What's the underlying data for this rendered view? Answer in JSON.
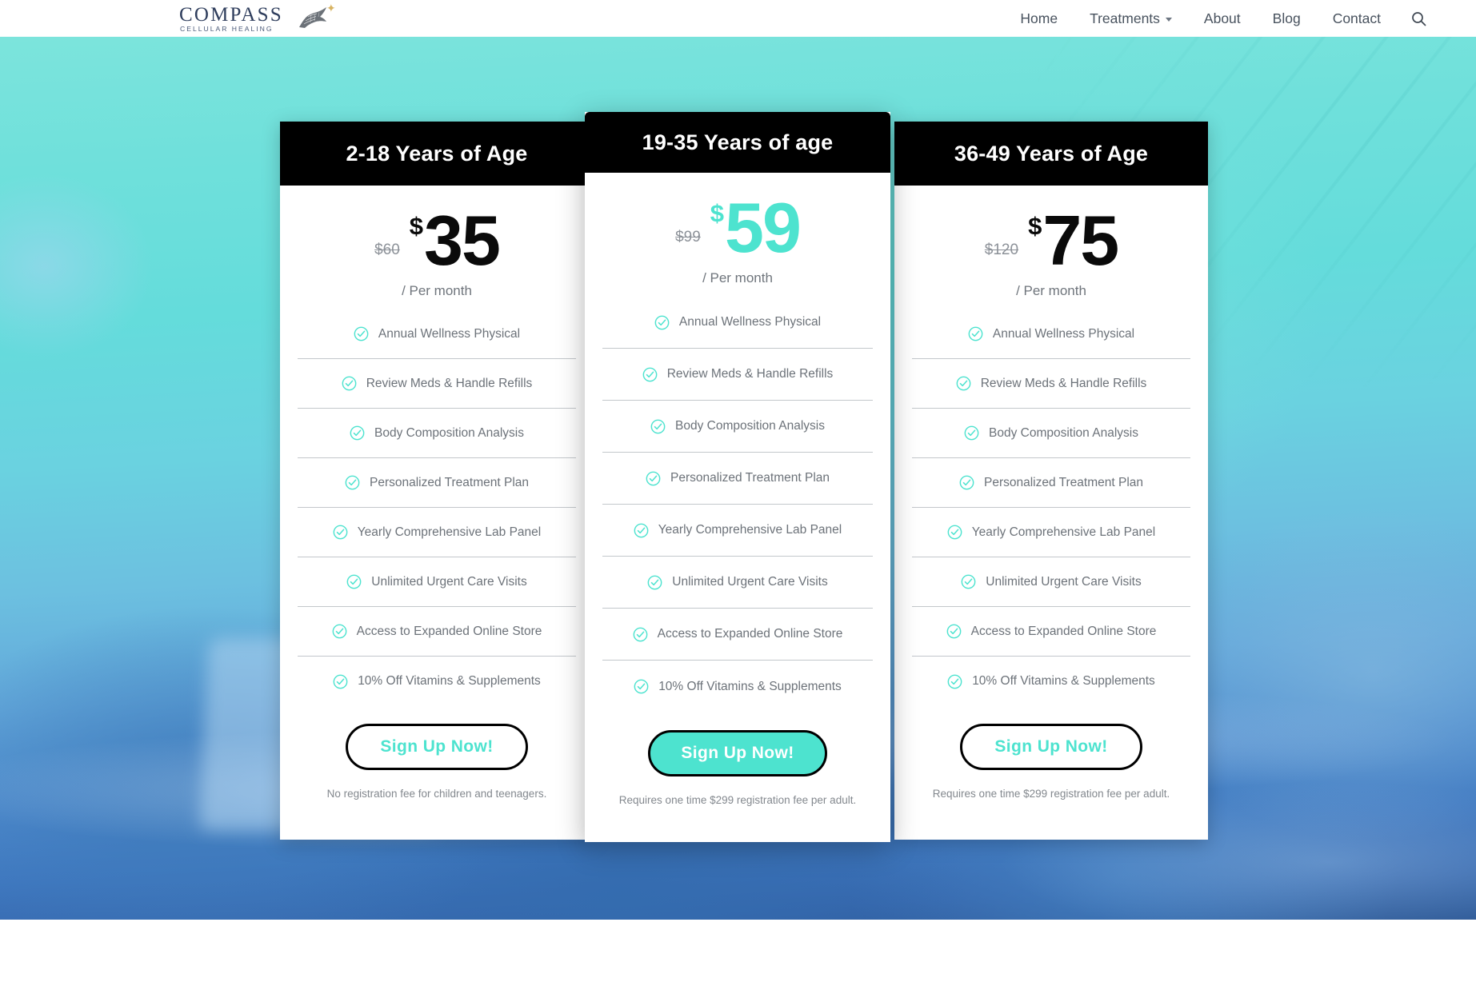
{
  "brand": {
    "name": "COMPASS",
    "tagline": "CELLULAR HEALING",
    "accent_color": "#4de3cf",
    "logo_text_color": "#2e3d5c"
  },
  "nav": {
    "items": [
      {
        "label": "Home",
        "has_dropdown": false
      },
      {
        "label": "Treatments",
        "has_dropdown": true
      },
      {
        "label": "About",
        "has_dropdown": false
      },
      {
        "label": "Blog",
        "has_dropdown": false
      },
      {
        "label": "Contact",
        "has_dropdown": false
      }
    ],
    "search_icon": "search-icon"
  },
  "pricing": {
    "cards": [
      {
        "title": "2-18 Years of Age",
        "old_price": "$60",
        "currency": "$",
        "price": "35",
        "period": "/ Per month",
        "price_color": "#0a0a0a",
        "features": [
          "Annual Wellness Physical",
          "Review Meds & Handle Refills",
          "Body Composition Analysis",
          "Personalized Treatment Plan",
          "Yearly Comprehensive Lab Panel",
          "Unlimited Urgent Care Visits",
          "Access to Expanded Online Store",
          "10% Off Vitamins & Supplements"
        ],
        "cta_label": "Sign Up Now!",
        "cta_style": "outline",
        "footnote": "No registration fee for children and teenagers."
      },
      {
        "title": "19-35 Years of age",
        "old_price": "$99",
        "currency": "$",
        "price": "59",
        "period": "/ Per month",
        "price_color": "#4de3cf",
        "features": [
          "Annual Wellness Physical",
          "Review Meds & Handle Refills",
          "Body Composition Analysis",
          "Personalized Treatment Plan",
          "Yearly Comprehensive Lab Panel",
          "Unlimited Urgent Care Visits",
          "Access to Expanded Online Store",
          "10% Off Vitamins & Supplements"
        ],
        "cta_label": "Sign Up Now!",
        "cta_style": "filled",
        "footnote": "Requires one time $299 registration fee per adult."
      },
      {
        "title": "36-49 Years of Age",
        "old_price": "$120",
        "currency": "$",
        "price": "75",
        "period": "/ Per month",
        "price_color": "#0a0a0a",
        "features": [
          "Annual Wellness Physical",
          "Review Meds & Handle Refills",
          "Body Composition Analysis",
          "Personalized Treatment Plan",
          "Yearly Comprehensive Lab Panel",
          "Unlimited Urgent Care Visits",
          "Access to Expanded Online Store",
          "10% Off Vitamins & Supplements"
        ],
        "cta_label": "Sign Up Now!",
        "cta_style": "outline",
        "footnote": "Requires one time $299 registration fee per adult."
      }
    ]
  }
}
